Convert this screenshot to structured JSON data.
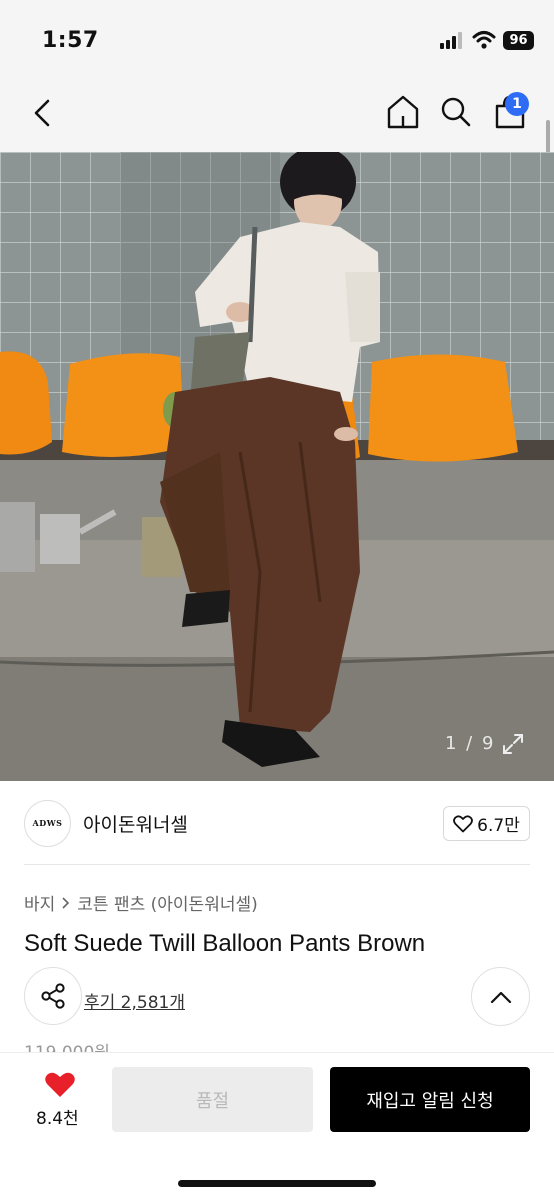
{
  "status_bar": {
    "time": "1:57",
    "battery": "96"
  },
  "nav": {
    "cart_count": "1"
  },
  "gallery": {
    "counter": "1 / 9"
  },
  "brand": {
    "logo_text": "ADWS",
    "name": "아이돈워너셀",
    "likes": "6.7만"
  },
  "product": {
    "breadcrumb": [
      "바지",
      "코튼 팬츠 (아이돈워너셀)"
    ],
    "title": "Soft Suede Twill Balloon Pants Brown",
    "reviews": "후기 2,581개",
    "price": "119,000원"
  },
  "bottom_bar": {
    "wish_count": "8.4천",
    "soldout_label": "품절",
    "restock_label": "재입고 알림 신청"
  },
  "colors": {
    "accent_blue": "#2f6cf6",
    "wish_red": "#e8202a",
    "primary_black": "#000000"
  }
}
